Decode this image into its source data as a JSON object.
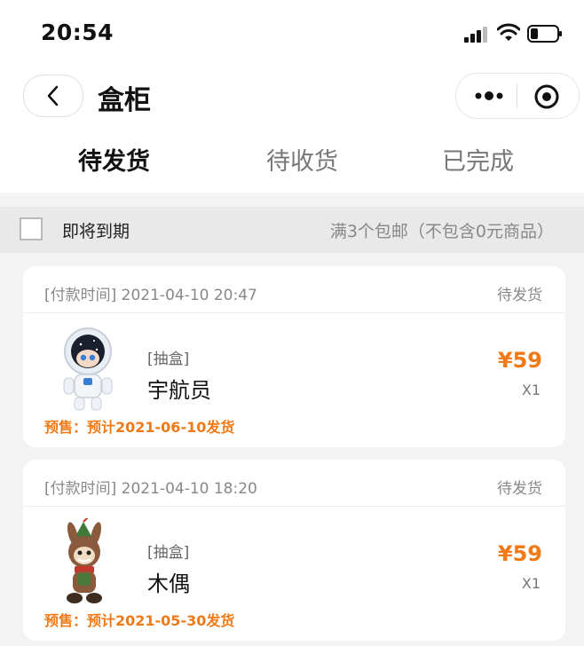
{
  "status_bar": {
    "time": "20:54"
  },
  "header": {
    "title": "盒柜",
    "back_icon": "chevron-left-icon",
    "more_icon": "more-dots-icon",
    "target_icon": "record-target-icon"
  },
  "tabs": [
    {
      "label": "待发货",
      "active": true
    },
    {
      "label": "待收货",
      "active": false
    },
    {
      "label": "已完成",
      "active": false
    }
  ],
  "filter": {
    "checkbox_label": "即将到期",
    "note": "满3个包邮（不包含0元商品）"
  },
  "orders": [
    {
      "payment_time": "[付款时间] 2021-04-10 20:47",
      "status": "待发货",
      "tag": "[抽盒]",
      "name": "宇航员",
      "price": "¥59",
      "quantity": "X1",
      "presale": "预售：预计2021-06-10发货",
      "thumb_icon": "astronaut-figure"
    },
    {
      "payment_time": "[付款时间] 2021-04-10 18:20",
      "status": "待发货",
      "tag": "[抽盒]",
      "name": "木偶",
      "price": "¥59",
      "quantity": "X1",
      "presale": "预售：预计2021-05-30发货",
      "thumb_icon": "puppet-figure"
    }
  ],
  "colors": {
    "accent": "#f07a17",
    "muted": "#888888",
    "background": "#f3f3f3"
  }
}
